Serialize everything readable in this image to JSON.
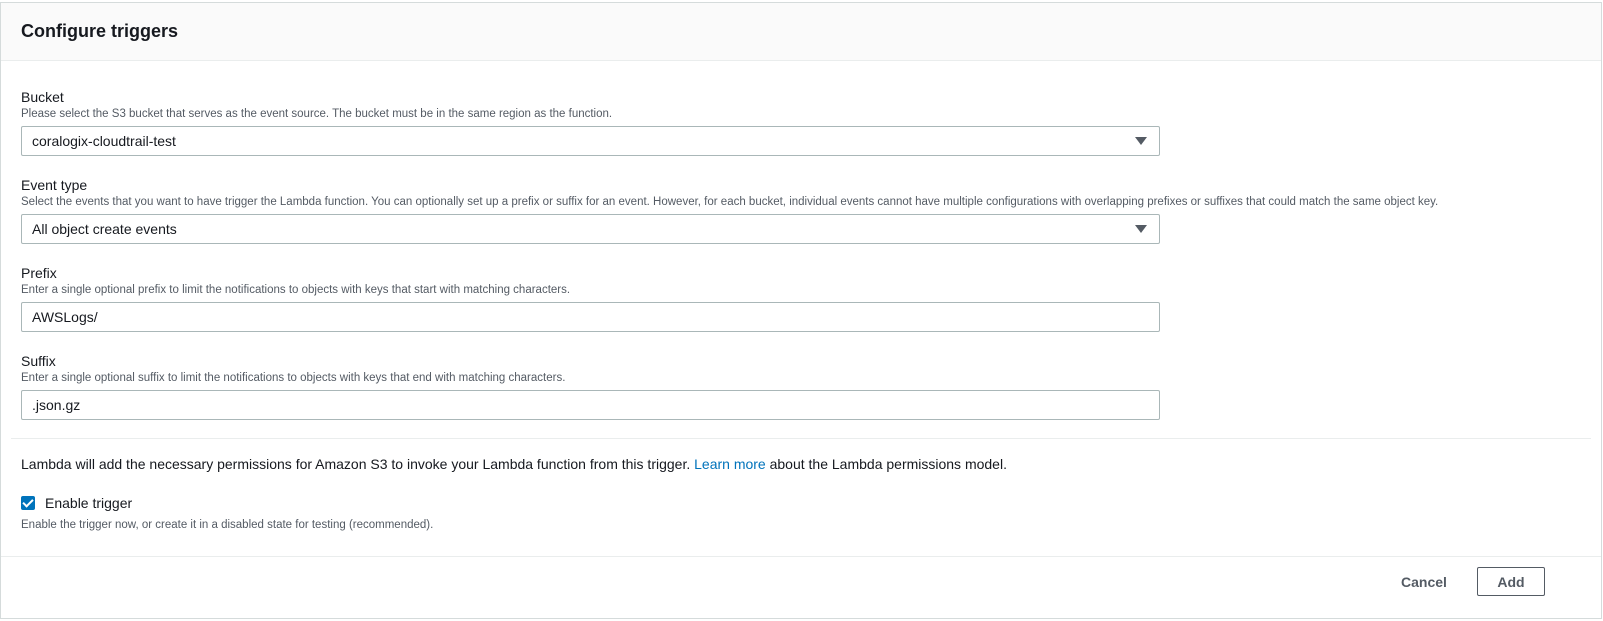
{
  "panel": {
    "title": "Configure triggers"
  },
  "bucket": {
    "label": "Bucket",
    "description": "Please select the S3 bucket that serves as the event source. The bucket must be in the same region as the function.",
    "value": "coralogix-cloudtrail-test"
  },
  "event_type": {
    "label": "Event type",
    "description": "Select the events that you want to have trigger the Lambda function. You can optionally set up a prefix or suffix for an event. However, for each bucket, individual events cannot have multiple configurations with overlapping prefixes or suffixes that could match the same object key.",
    "value": "All object create events"
  },
  "prefix": {
    "label": "Prefix",
    "description": "Enter a single optional prefix to limit the notifications to objects with keys that start with matching characters.",
    "value": "AWSLogs/"
  },
  "suffix": {
    "label": "Suffix",
    "description": "Enter a single optional suffix to limit the notifications to objects with keys that end with matching characters.",
    "value": ".json.gz"
  },
  "permissions": {
    "text_before": "Lambda will add the necessary permissions for Amazon S3 to invoke your Lambda function from this trigger. ",
    "link": "Learn more",
    "text_after": " about the Lambda permissions model."
  },
  "enable_trigger": {
    "label": "Enable trigger",
    "checked": true,
    "description": "Enable the trigger now, or create it in a disabled state for testing (recommended)."
  },
  "footer": {
    "cancel_label": "Cancel",
    "add_label": "Add"
  },
  "colors": {
    "accent": "#0073bb",
    "border": "#aab7b8",
    "muted_text": "#545b64"
  }
}
